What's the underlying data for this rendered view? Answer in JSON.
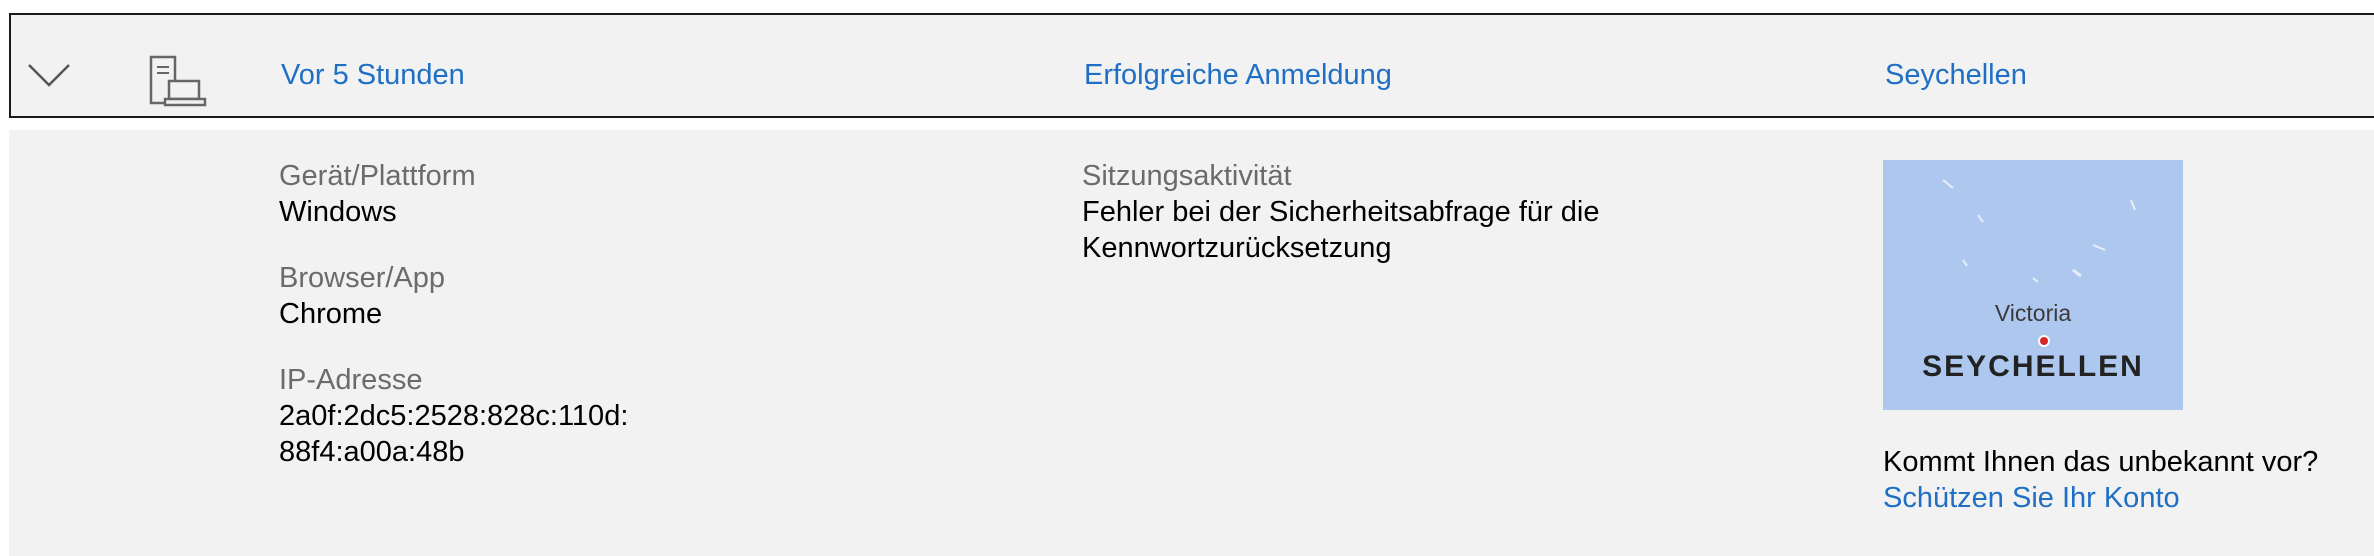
{
  "header": {
    "time": "Vor 5 Stunden",
    "event": "Erfolgreiche Anmeldung",
    "location": "Seychellen",
    "expand_icon": "chevron-down-icon",
    "device_icon": "desktop-laptop-icon"
  },
  "details": {
    "device_label": "Gerät/Plattform",
    "device_value": "Windows",
    "browser_label": "Browser/App",
    "browser_value": "Chrome",
    "ip_label": "IP-Adresse",
    "ip_line1": "2a0f:2dc5:2528:828c:110d:",
    "ip_line2": "88f4:a00a:48b",
    "session_label": "Sitzungsaktivität",
    "session_line1": "Fehler bei der Sicherheitsabfrage für die",
    "session_line2": "Kennwortzurücksetzung"
  },
  "map": {
    "city": "Victoria",
    "country": "SEYCHELLEN"
  },
  "unfamiliar": {
    "question": "Kommt Ihnen das unbekannt vor?",
    "link": "Schützen Sie Ihr Konto"
  },
  "colors": {
    "link": "#1f6fc5",
    "panel_bg": "#f2f2f2",
    "map_water": "#aec7ef"
  }
}
